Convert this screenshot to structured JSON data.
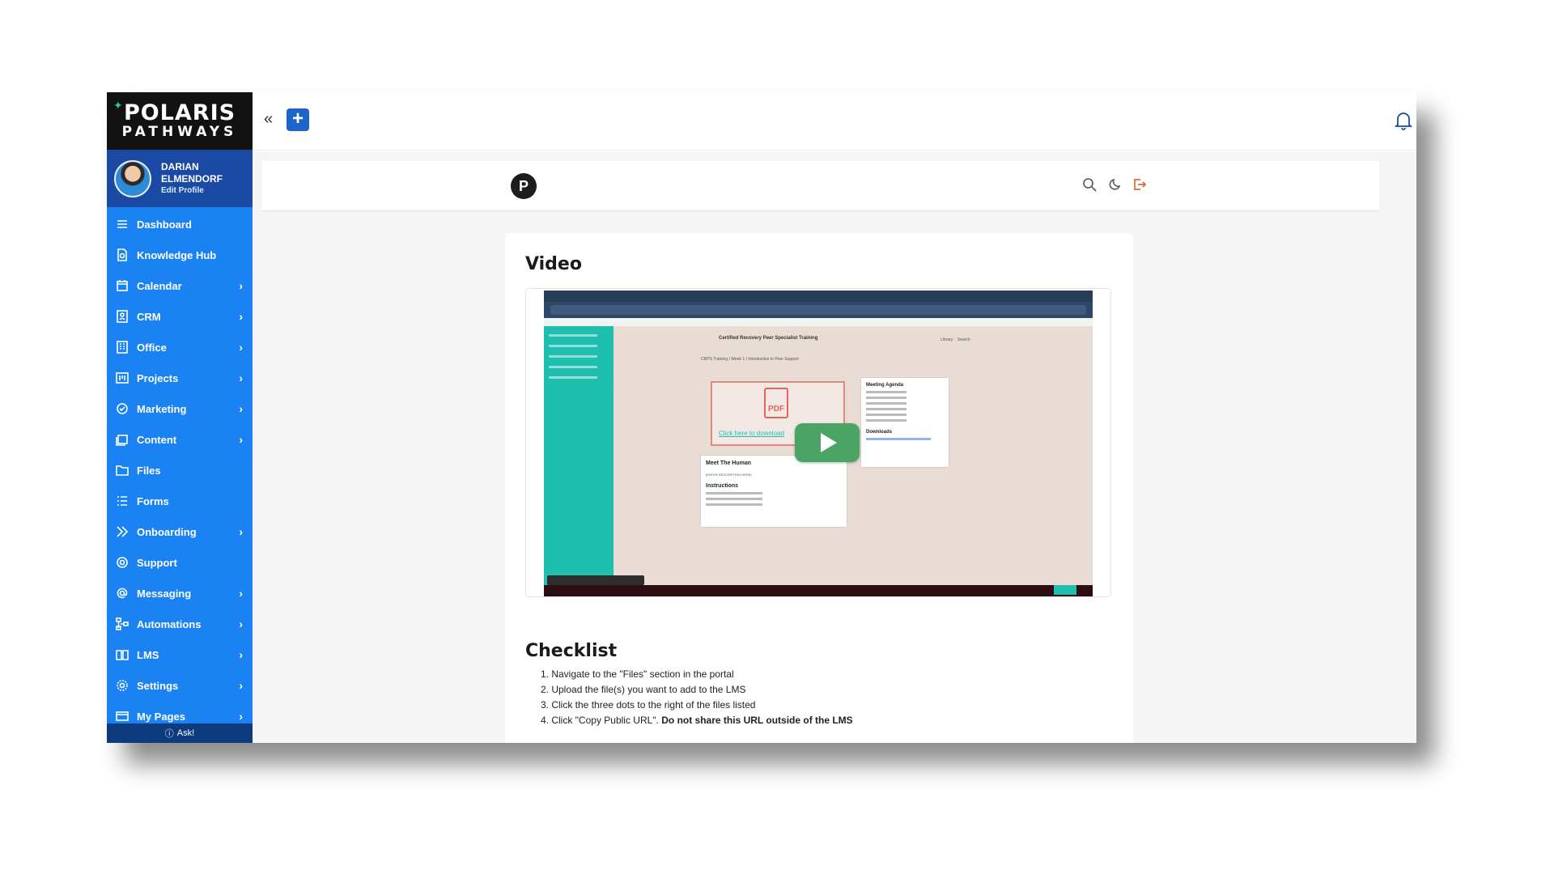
{
  "brand": {
    "line1": "POLARIS",
    "line2": "PATHWAYS"
  },
  "profile": {
    "name_first": "DARIAN",
    "name_last": "ELMENDORF",
    "edit_label": "Edit Profile"
  },
  "nav": [
    {
      "label": "Dashboard",
      "icon": "menu-icon",
      "chevron": ""
    },
    {
      "label": "Knowledge Hub",
      "icon": "document-search-icon",
      "chevron": ""
    },
    {
      "label": "Calendar",
      "icon": "calendar-icon",
      "chevron": "›"
    },
    {
      "label": "CRM",
      "icon": "contact-card-icon",
      "chevron": "›"
    },
    {
      "label": "Office",
      "icon": "office-icon",
      "chevron": "›"
    },
    {
      "label": "Projects",
      "icon": "kanban-icon",
      "chevron": "›"
    },
    {
      "label": "Marketing",
      "icon": "megaphone-icon",
      "chevron": "›"
    },
    {
      "label": "Content",
      "icon": "content-icon",
      "chevron": "›"
    },
    {
      "label": "Files",
      "icon": "folder-icon",
      "chevron": ""
    },
    {
      "label": "Forms",
      "icon": "form-list-icon",
      "chevron": ""
    },
    {
      "label": "Onboarding",
      "icon": "double-chevron-icon",
      "chevron": "›"
    },
    {
      "label": "Support",
      "icon": "support-icon",
      "chevron": ""
    },
    {
      "label": "Messaging",
      "icon": "at-sign-icon",
      "chevron": "›"
    },
    {
      "label": "Automations",
      "icon": "flow-icon",
      "chevron": "›"
    },
    {
      "label": "LMS",
      "icon": "book-icon",
      "chevron": "›"
    },
    {
      "label": "Settings",
      "icon": "gear-icon",
      "chevron": "›"
    },
    {
      "label": "My Pages",
      "icon": "pages-icon",
      "chevron": "›"
    }
  ],
  "ask": {
    "label": "Ask!"
  },
  "topbar": {
    "collapse_glyph": "«",
    "add_glyph": "+"
  },
  "inner": {
    "logo_glyph": "P"
  },
  "video_section": {
    "title": "Video"
  },
  "video": {
    "course_title": "Certified Recovery Peer Specialist Training",
    "crumb": "CRPS Training / Week 1 / Introduction to Peer Support",
    "library": "Library",
    "search": "Search",
    "pdf_label": "PDF",
    "pdf_link": "Click here to download",
    "agenda_title": "Meeting Agenda",
    "downloads_title": "Downloads",
    "human_title": "Meet The Human",
    "human_desc": "[ENTER DESCRIPTION HERE]",
    "instructions_title": "Instructions"
  },
  "checklist_section": {
    "title": "Checklist"
  },
  "checklist": {
    "items": [
      "1. Navigate to the \"Files\" section in the portal",
      "2. Upload the file(s) you want to add to the LMS",
      "3. Click the three dots to the right of the files listed",
      "4. Click \"Copy Public URL\". "
    ],
    "warning": "Do not share this URL outside of the LMS"
  },
  "colors": {
    "sidebar": "#1b82f3",
    "profile_bg": "#1a4aa3",
    "ask_bg": "#0e3a7e",
    "accent": "#1f64c8",
    "teal": "#1fbfb0",
    "play": "#4aa564"
  }
}
